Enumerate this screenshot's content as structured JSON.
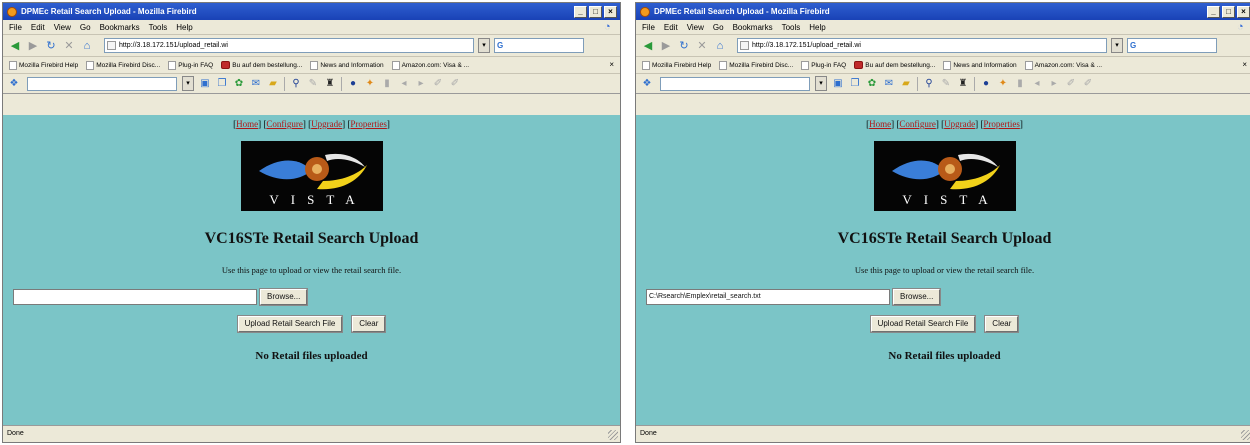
{
  "browser": {
    "title": "DPMEc Retail Search Upload - Mozilla Firebird",
    "menu": [
      "File",
      "Edit",
      "View",
      "Go",
      "Bookmarks",
      "Tools",
      "Help"
    ],
    "url": "http://3.18.172.151/upload_retail.wi",
    "search_value": "G",
    "bookmarks": [
      "Mozilla Firebird Help",
      "Mozilla Firebird Disc...",
      "Plug-in FAQ",
      "Bu auf dem bestellung...",
      "News and Information",
      "Amazon.com: Visa & ..."
    ],
    "status_left": "Done"
  },
  "page": {
    "nav": [
      "Home",
      "Configure",
      "Upgrade",
      "Properties"
    ],
    "logo_text": "VISTA",
    "heading": "VC16STe Retail Search Upload",
    "instructions": "Use this page to upload or view the retail search file.",
    "browse_label": "Browse...",
    "upload_label": "Upload Retail Search File",
    "clear_label": "Clear",
    "status_text": "No Retail files uploaded"
  },
  "left": {
    "file_value": ""
  },
  "right": {
    "file_value": "C:\\Rsearch\\Emplex\\retail_search.txt"
  },
  "colors": {
    "page_bg": "#7bc5c7",
    "titlebar": "#1942b6",
    "nav_link": "#b01818"
  }
}
